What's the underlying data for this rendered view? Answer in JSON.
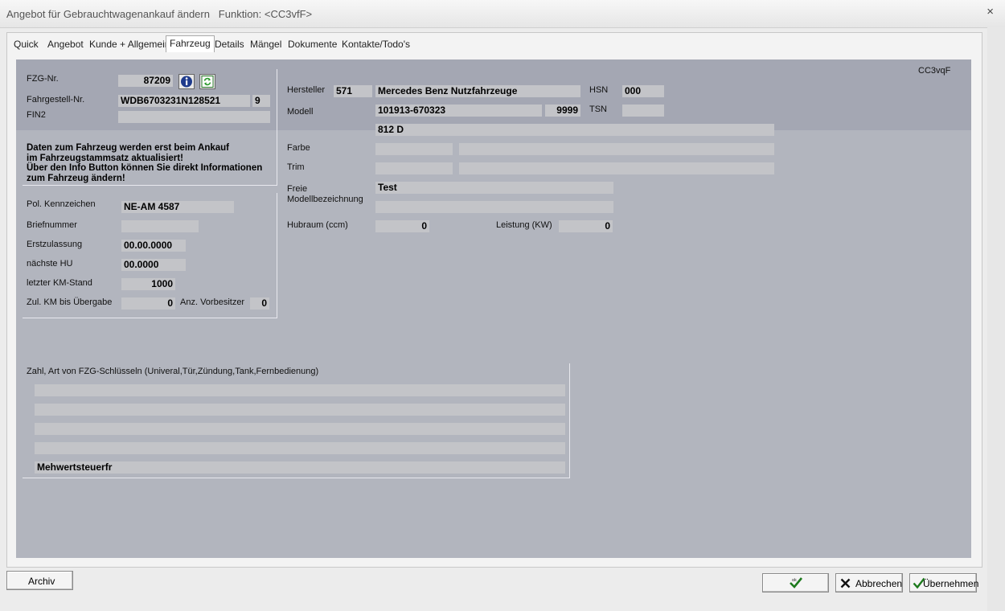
{
  "window": {
    "title": "Angebot für Gebrauchtwagenankauf ändern   Funktion: <CC3vfF>",
    "close_glyph": "×"
  },
  "tabs": [
    {
      "label": "Quick"
    },
    {
      "label": "Angebot"
    },
    {
      "label": "Kunde + Allgemein"
    },
    {
      "label": "Fahrzeug",
      "active": true
    },
    {
      "label": "Details"
    },
    {
      "label": "Mängel"
    },
    {
      "label": "Dokumente"
    },
    {
      "label": "Kontakte/Todo's"
    }
  ],
  "panel": {
    "code": "CC3vqF",
    "colors": {
      "background_top": "#a4a7b3",
      "background": "#b2b5be",
      "field": "#c3c4c8"
    }
  },
  "vehicle": {
    "fzg_nr_label": "FZG-Nr.",
    "fzg_nr": "87209",
    "fahrgestell_label": "Fahrgestell-Nr.",
    "fahrgestell": "WDB6703231N128521",
    "fahrgestell_check": "9",
    "fin2_label": "FIN2",
    "fin2": "",
    "info_icon": "info-icon",
    "refresh_icon": "refresh-icon",
    "note_lines": [
      "Daten zum Fahrzeug werden erst beim Ankauf",
      "im Fahrzeugstammsatz aktualisiert!",
      "Über den Info Button können Sie direkt Informationen",
      "zum Fahrzeug ändern!"
    ]
  },
  "registration": {
    "kennzeichen_label": "Pol. Kennzeichen",
    "kennzeichen": "NE-AM 4587",
    "briefnummer_label": "Briefnummer",
    "briefnummer": "",
    "erstzulassung_label": "Erstzulassung",
    "erstzulassung": "00.00.0000",
    "naechste_hu_label": "nächste HU",
    "naechste_hu": "00.0000",
    "km_stand_label": "letzter KM-Stand",
    "km_stand": "1000",
    "zul_km_label": "Zul. KM bis Übergabe",
    "zul_km": "0",
    "vorbesitzer_label": "Anz. Vorbesitzer",
    "vorbesitzer": "0"
  },
  "model": {
    "hersteller_label": "Hersteller",
    "hersteller_code": "571",
    "hersteller_name": "Mercedes Benz Nutzfahrzeuge",
    "hsn_label": "HSN",
    "hsn": "000",
    "modell_label": "Modell",
    "modell": "101913-670323",
    "modell_num": "9999",
    "tsn_label": "TSN",
    "tsn": "",
    "modell_name": "812 D",
    "farbe_label": "Farbe",
    "farbe_code": "",
    "farbe_text": "",
    "trim_label": "Trim",
    "trim_code": "",
    "trim_text": "",
    "freie_label_1": "Freie",
    "freie_label_2": "Modellbezeichnung",
    "freie_1": "Test",
    "freie_2": "",
    "hubraum_label": "Hubraum (ccm)",
    "hubraum": "0",
    "leistung_label": "Leistung (KW)",
    "leistung": "0"
  },
  "keys": {
    "label": "Zahl, Art von FZG-Schlüsseln (Univeral,Tür,Zündung,Tank,Fernbedienung)",
    "lines": [
      "",
      "",
      "",
      ""
    ],
    "vat": "Mehwertsteuerfr"
  },
  "buttons": {
    "archiv": "Archiv",
    "ok_icon": "ok-check-icon",
    "abbrechen": "Abbrechen",
    "uebernehmen": "Übernehmen"
  }
}
